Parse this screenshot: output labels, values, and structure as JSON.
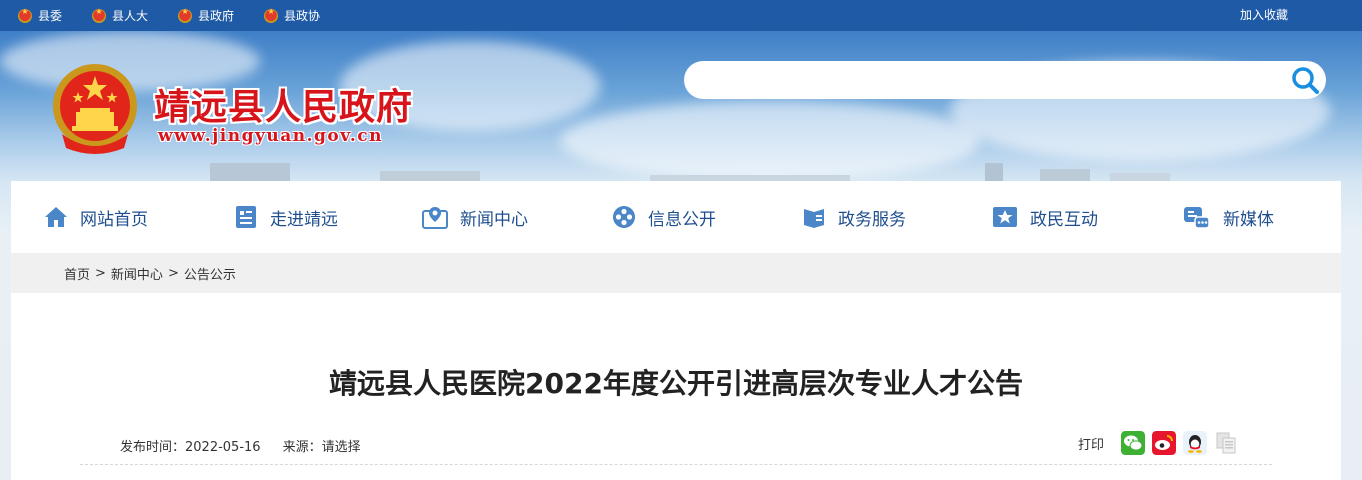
{
  "topbar": {
    "links": [
      "县委",
      "县人大",
      "县政府",
      "县政协"
    ],
    "favorite": "加入收藏"
  },
  "header": {
    "title": "靖远县人民政府",
    "url": "www.jingyuan.gov.cn",
    "search_value": ""
  },
  "nav": {
    "items": [
      "网站首页",
      "走进靖远",
      "新闻中心",
      "信息公开",
      "政务服务",
      "政民互动",
      "新媒体"
    ]
  },
  "breadcrumb": {
    "home": "首页",
    "sep1": ">",
    "section": "新闻中心",
    "sep2": ">",
    "current": "公告公示"
  },
  "article": {
    "title": "靖远县人民医院2022年度公开引进高层次专业人才公告",
    "publish_label": "发布时间：2022-05-16",
    "source_label": "来源：请选择"
  },
  "share": {
    "print": "打印",
    "icons": [
      "wechat-icon",
      "weibo-icon",
      "qq-icon",
      "copy-icon"
    ]
  },
  "colors": {
    "topbar": "#1f5aa6",
    "nav_text": "#1f4f8f",
    "title_red": "#d8141b"
  }
}
